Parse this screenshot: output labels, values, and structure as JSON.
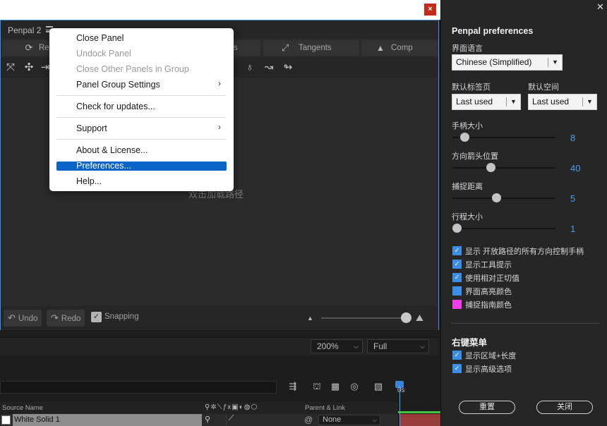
{
  "panel": {
    "title": "Penpal 2",
    "tabs": [
      {
        "icon": "refresh-icon",
        "label": "Re"
      },
      {
        "icon": "tangents-icon",
        "label": "Tangents"
      },
      {
        "icon": "comp-icon",
        "label": "Comp"
      }
    ],
    "tab_fragment": "s",
    "canvas_hint": "双击加载路径",
    "undo_label": "Undo",
    "redo_label": "Redo",
    "snapping_label": "Snapping"
  },
  "menu": {
    "items": [
      {
        "label": "Close Panel",
        "enabled": true
      },
      {
        "label": "Undock Panel",
        "enabled": false
      },
      {
        "label": "Close Other Panels in Group",
        "enabled": false
      },
      {
        "label": "Panel Group Settings",
        "enabled": true,
        "submenu": true
      },
      {
        "label": "Check for updates...",
        "enabled": true
      },
      {
        "label": "Support",
        "enabled": true,
        "submenu": true
      },
      {
        "label": "About & License...",
        "enabled": true
      },
      {
        "label": "Preferences...",
        "enabled": true,
        "highlighted": true
      },
      {
        "label": "Help...",
        "enabled": true
      }
    ]
  },
  "viewer": {
    "zoom": "200%",
    "resolution": "Full"
  },
  "timeline": {
    "timecode": "0s",
    "columns": {
      "source_name": "Source Name",
      "parent_link": "Parent & Link"
    },
    "layer": {
      "name": "White Solid 1",
      "parent": "None"
    }
  },
  "prefs": {
    "title": "Penpal preferences",
    "language_label": "界面语言",
    "language_value": "Chinese (Simplified)",
    "default_tag_label": "默认标签页",
    "default_tag_value": "Last used",
    "default_space_label": "默认空间",
    "default_space_value": "Last used",
    "sliders": [
      {
        "label": "手柄大小",
        "value": "8",
        "fraction": 0.08
      },
      {
        "label": "方向箭头位置",
        "value": "40",
        "fraction": 0.36
      },
      {
        "label": "捕捉距离",
        "value": "5",
        "fraction": 0.42
      },
      {
        "label": "行程大小",
        "value": "1",
        "fraction": 0.0
      }
    ],
    "checkboxes": [
      {
        "label": "显示 开放路径的所有方向控制手柄",
        "checked": true
      },
      {
        "label": "显示工具提示",
        "checked": true
      },
      {
        "label": "使用相对正切值",
        "checked": true
      }
    ],
    "colors": [
      {
        "label": "界面高亮颜色",
        "color": "#3a8ee6"
      },
      {
        "label": "捕捉指南颜色",
        "color": "#f23ee8"
      }
    ],
    "context_menu_title": "右键菜单",
    "context_checkboxes": [
      {
        "label": "显示区域+长度",
        "checked": true
      },
      {
        "label": "显示高级选项",
        "checked": true
      }
    ],
    "reset_label": "重置",
    "close_label": "关闭"
  },
  "colors": {
    "accent": "#3a8ee6",
    "menu_highlight": "#0a64c8",
    "close_red": "#c42b1c"
  }
}
